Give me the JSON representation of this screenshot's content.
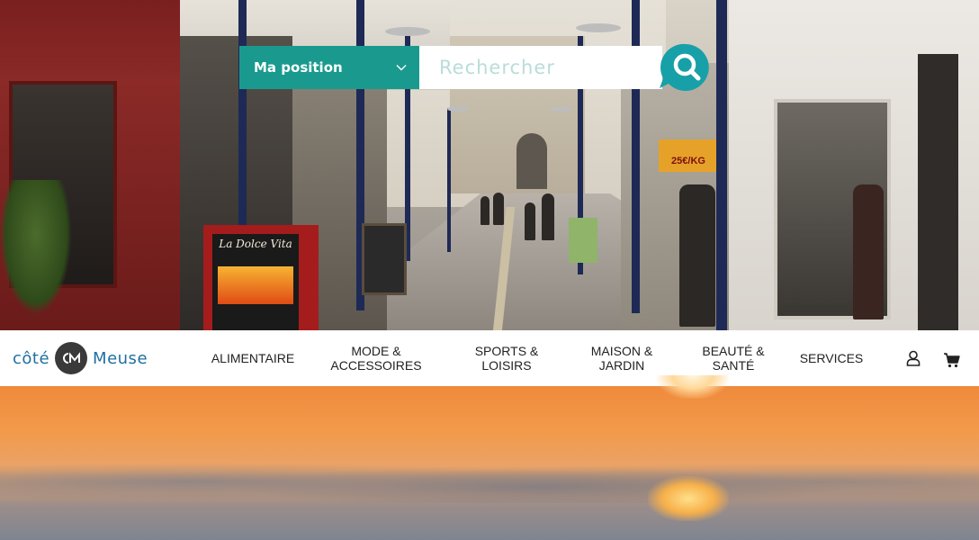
{
  "search": {
    "position_label": "Ma position",
    "placeholder": "Rechercher"
  },
  "hero": {
    "board_title": "La Dolce Vita",
    "sign_text": "25€/KG"
  },
  "logo": {
    "left_word": "côté",
    "mark_text": "CM",
    "right_word": "Meuse"
  },
  "nav": {
    "items": [
      {
        "line1": "ALIMENTAIRE",
        "line2": ""
      },
      {
        "line1": "MODE &",
        "line2": "ACCESSOIRES"
      },
      {
        "line1": "SPORTS &",
        "line2": "LOISIRS"
      },
      {
        "line1": "MAISON &",
        "line2": "JARDIN"
      },
      {
        "line1": "BEAUTÉ &",
        "line2": "SANTÉ"
      },
      {
        "line1": "SERVICES",
        "line2": ""
      }
    ],
    "icons": [
      "user-icon",
      "cart-icon"
    ]
  },
  "colors": {
    "accent": "#1a9a8e",
    "logo_blue": "#1f6fa0"
  }
}
